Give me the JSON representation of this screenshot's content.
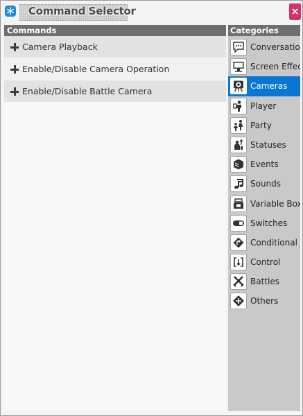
{
  "window": {
    "title": "Command Selector"
  },
  "icons": {
    "app": "snowflake-badge-icon",
    "close": "close-icon",
    "expand": "plus-icon"
  },
  "colors": {
    "accent": "#0a76d4",
    "close_button": "#d6336c",
    "panel_header": "#6e6e6e"
  },
  "commands": {
    "header": "Commands",
    "items": [
      {
        "label": "Camera Playback"
      },
      {
        "label": "Enable/Disable Camera Operation"
      },
      {
        "label": "Enable/Disable Battle Camera"
      }
    ]
  },
  "categories": {
    "header": "Categories",
    "selected": "Cameras",
    "items": [
      {
        "label": "Conversation",
        "icon": "speech-bubble-icon"
      },
      {
        "label": "Screen Effects",
        "icon": "monitor-icon"
      },
      {
        "label": "Cameras",
        "icon": "camera-icon"
      },
      {
        "label": "Player",
        "icon": "player-icon"
      },
      {
        "label": "Party",
        "icon": "party-icon"
      },
      {
        "label": "Statuses",
        "icon": "status-icon"
      },
      {
        "label": "Events",
        "icon": "cube-icon"
      },
      {
        "label": "Sounds",
        "icon": "music-note-icon"
      },
      {
        "label": "Variable Boxes",
        "icon": "variable-box-icon"
      },
      {
        "label": "Switches",
        "icon": "toggle-switch-icon"
      },
      {
        "label": "Conditional Jumps",
        "icon": "conditional-jump-icon"
      },
      {
        "label": "Control",
        "icon": "loop-arrows-icon"
      },
      {
        "label": "Battles",
        "icon": "crossed-swords-icon"
      },
      {
        "label": "Others",
        "icon": "diamond-plus-icon"
      }
    ]
  }
}
